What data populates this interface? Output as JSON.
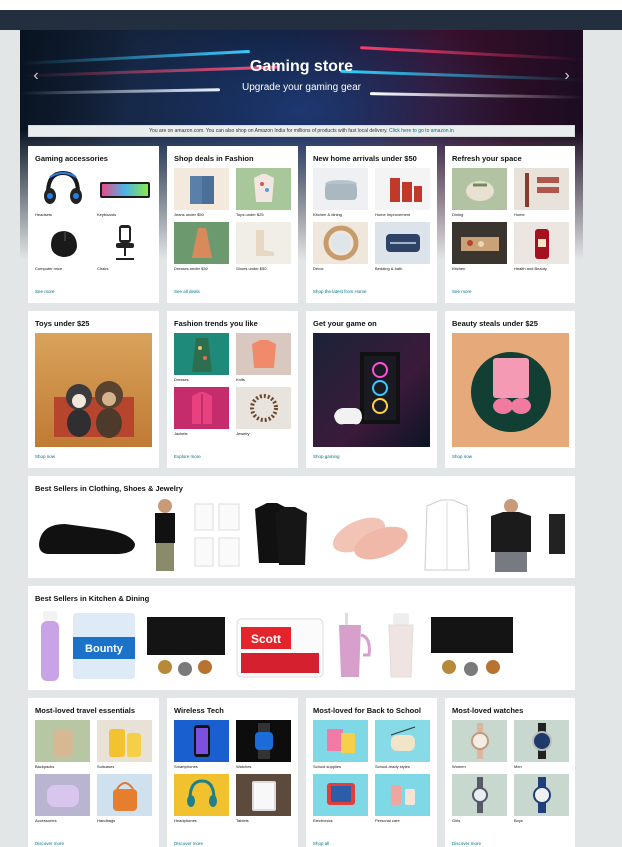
{
  "banner": {
    "title": "Gaming store",
    "subtitle": "Upgrade your gaming gear",
    "prev_icon": "chevron-left-icon",
    "next_icon": "chevron-right-icon"
  },
  "notice": {
    "text": "You are on amazon.com. You can also shop on Amazon India for millions of products with fast local delivery.",
    "link": "Click here to go to amazon.in"
  },
  "cards_row1": [
    {
      "title": "Gaming accessories",
      "items": [
        "Headsets",
        "Keyboards",
        "Computer mice",
        "Chairs"
      ],
      "link": "See more"
    },
    {
      "title": "Shop deals in Fashion",
      "items": [
        "Jeans under $50",
        "Tops under $25",
        "Dresses under $30",
        "Shoes under $50"
      ],
      "link": "See all deals"
    },
    {
      "title": "New home arrivals under $50",
      "items": [
        "Kitchen & dining",
        "Home Improvement",
        "Décor",
        "Bedding & bath"
      ],
      "link": "Shop the latest from Home"
    },
    {
      "title": "Refresh your space",
      "items": [
        "Dining",
        "Home",
        "Kitchen",
        "Health and Beauty"
      ],
      "link": "See more"
    }
  ],
  "cards_row2": [
    {
      "title": "Toys under $25",
      "link": "Shop now"
    },
    {
      "title": "Fashion trends you like",
      "items": [
        "Dresses",
        "Knits",
        "Jackets",
        "Jewelry"
      ],
      "link": "Explore more"
    },
    {
      "title": "Get your game on",
      "link": "Shop gaming"
    },
    {
      "title": "Beauty steals under $25",
      "link": "Shop now"
    }
  ],
  "bestsellers_clothing": {
    "title": "Best Sellers in Clothing, Shoes & Jewelry"
  },
  "bestsellers_kitchen": {
    "title": "Best Sellers in Kitchen & Dining",
    "bounty_label": "Bounty",
    "scott_label": "Scott"
  },
  "cards_row3": [
    {
      "title": "Most-loved travel essentials",
      "items": [
        "Backpacks",
        "Suitcases",
        "Accessories",
        "Handbags"
      ],
      "link": "Discover more"
    },
    {
      "title": "Wireless Tech",
      "items": [
        "Smartphones",
        "Watches",
        "Headphones",
        "Tablets"
      ],
      "link": "Discover more"
    },
    {
      "title": "Most-loved for Back to School",
      "items": [
        "School supplies",
        "School-ready styles",
        "Electronics",
        "Personal care"
      ],
      "link": "Shop all"
    },
    {
      "title": "Most-loved watches",
      "items": [
        "Women",
        "Men",
        "Girls",
        "Boys"
      ],
      "link": "Discover more"
    }
  ]
}
